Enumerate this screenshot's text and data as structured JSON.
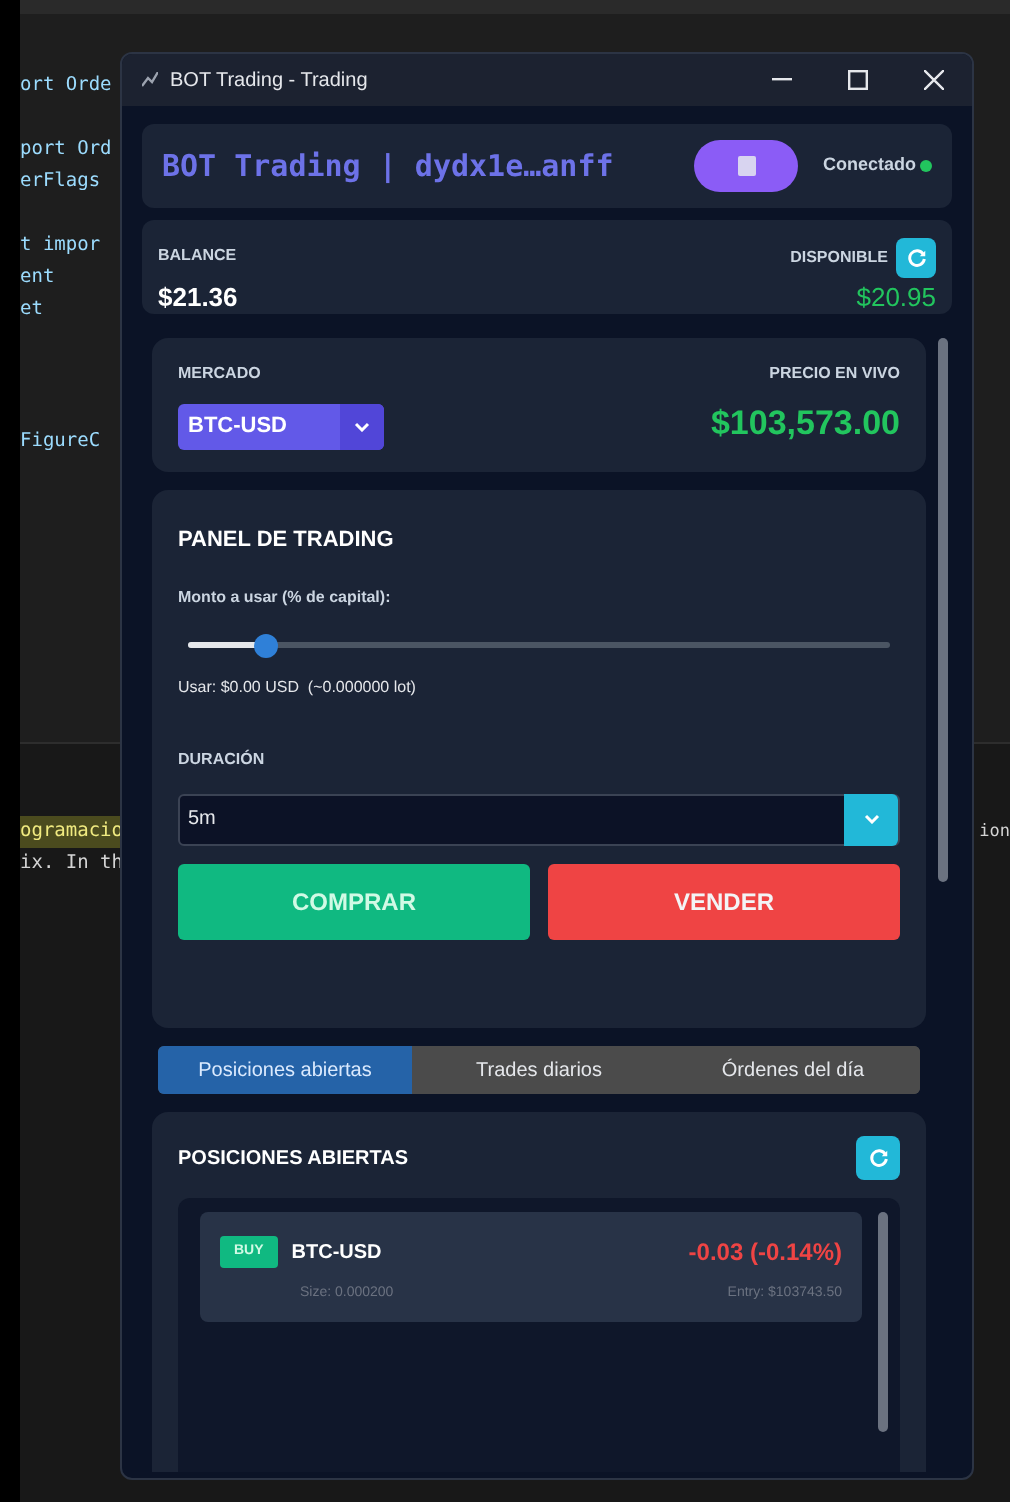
{
  "editor": {
    "lines_top": [
      "ort Orde",
      "port Ord",
      "erFlags",
      "t impor",
      "ent",
      "et",
      "FigureC"
    ],
    "lines_bottom": [
      {
        "text": "ogramacio",
        "highlighted": true
      },
      {
        "text": "ix. In th",
        "highlighted": false
      }
    ],
    "right_text": "ion"
  },
  "window": {
    "title": "BOT Trading - Trading"
  },
  "header": {
    "title": "BOT Trading | dydx1e…anff",
    "status": "Conectado",
    "connected": true
  },
  "balance": {
    "label": "BALANCE",
    "value": "$21.36",
    "available_label": "DISPONIBLE",
    "available_value": "$20.95"
  },
  "market": {
    "label": "MERCADO",
    "symbol": "BTC-USD",
    "price_label": "PRECIO EN VIVO",
    "price": "$103,573.00"
  },
  "trading_panel": {
    "title": "PANEL DE TRADING",
    "amount_label": "Monto a usar (% de capital):",
    "amount": {
      "level": 0.11
    },
    "usage": "Usar: $0.00 USD  (~0.000000 lot)",
    "duration_label": "DURACIÓN",
    "duration": "5m",
    "buttons": [
      {
        "label": "COMPRAR",
        "kind": "buy"
      },
      {
        "label": "VENDER",
        "kind": "sell"
      }
    ]
  },
  "tabs": [
    {
      "label": "Posiciones abiertas",
      "selected": true
    },
    {
      "label": "Trades diarios",
      "selected": false
    },
    {
      "label": "Órdenes del día",
      "selected": false
    }
  ],
  "positions": {
    "title": "POSICIONES ABIERTAS",
    "items": [
      {
        "side": "BUY",
        "symbol": "BTC-USD",
        "pnl": "-0.03 (-0.14%)",
        "size": "Size: 0.000200",
        "entry": "Entry: $103743.50"
      }
    ]
  }
}
